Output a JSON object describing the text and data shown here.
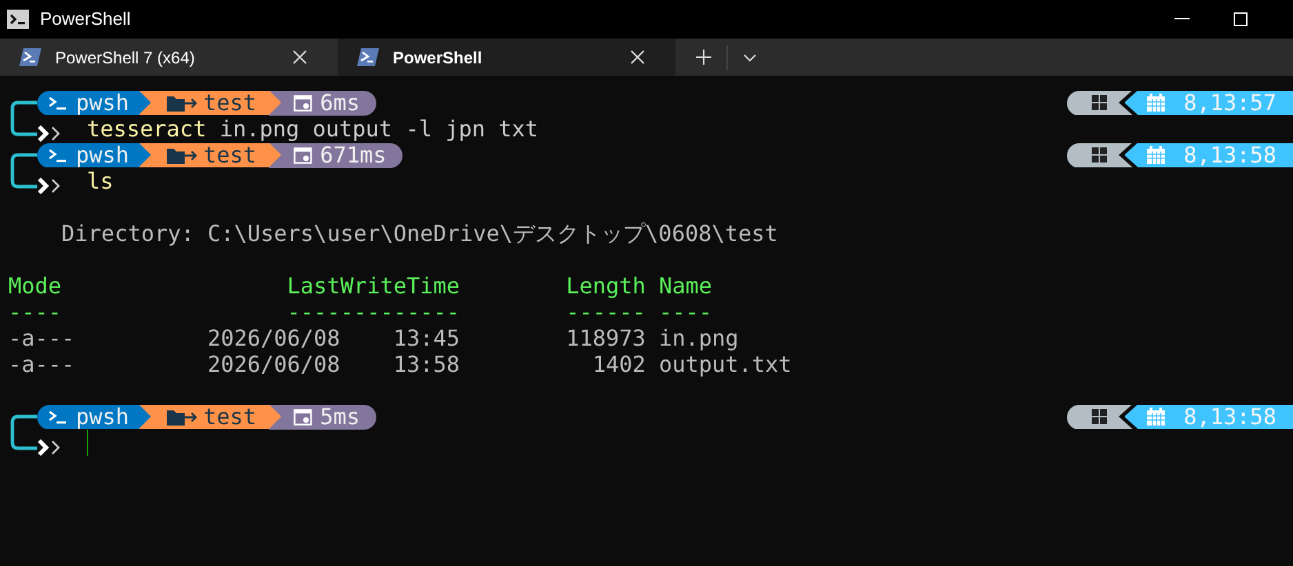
{
  "window": {
    "title": "PowerShell"
  },
  "tabs": [
    {
      "label": "PowerShell 7 (x64)",
      "selected": false
    },
    {
      "label": "PowerShell",
      "selected": true
    }
  ],
  "terminal": {
    "lines": [
      {
        "kind": "prompt",
        "shell": "pwsh",
        "path": "test",
        "duration": "6ms",
        "time": "8,13:57"
      },
      {
        "kind": "command",
        "program": "tesseract",
        "args": "in.png output -l jpn txt"
      },
      {
        "kind": "prompt",
        "shell": "pwsh",
        "path": "test",
        "duration": "671ms",
        "time": "8,13:58"
      },
      {
        "kind": "command",
        "program": "ls"
      },
      {
        "kind": "blank"
      },
      {
        "kind": "output",
        "text": "Directory: C:\\Users\\user\\OneDrive\\デスクトップ\\0608\\test"
      },
      {
        "kind": "blank"
      },
      {
        "kind": "table_header",
        "mode": "Mode",
        "last_write_time": "LastWriteTime",
        "length": "Length",
        "name": "Name"
      },
      {
        "kind": "table_rule",
        "mode": "----",
        "last_write_time": "-------------",
        "length": "------",
        "name": "----"
      },
      {
        "kind": "table_row",
        "mode": "-a---",
        "date": "2026/06/08",
        "time": "13:45",
        "length": "118973",
        "name": "in.png"
      },
      {
        "kind": "table_row",
        "mode": "-a---",
        "date": "2026/06/08",
        "time": "13:58",
        "length": "1402",
        "name": "output.txt"
      },
      {
        "kind": "blank"
      },
      {
        "kind": "prompt",
        "shell": "pwsh",
        "path": "test",
        "duration": "5ms",
        "time": "8,13:58"
      },
      {
        "kind": "input",
        "cursor": true
      }
    ]
  }
}
